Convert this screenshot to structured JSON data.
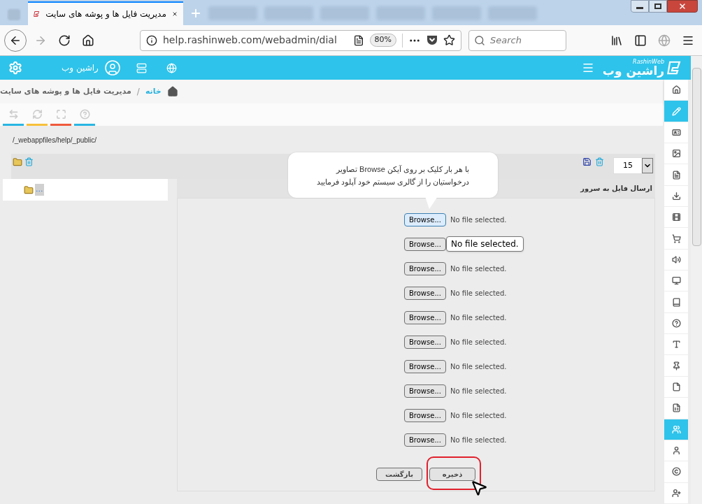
{
  "browser": {
    "tabs": [
      {
        "title": "مدیریت فایل ها و پوشه های سایت",
        "selected": true
      }
    ],
    "address": "help.rashinweb.com/webadmin/dial",
    "zoom": "80%",
    "search_placeholder": "Search"
  },
  "header": {
    "user_name": "راشین وب",
    "logo_text": "راشین وب",
    "logo_subtext": "RashinWeb"
  },
  "breadcrumb": {
    "separator": "/",
    "items": [
      {
        "label": "خانه",
        "link": true
      },
      {
        "label": "مدیریت فایل ها و پوشه های سایت",
        "link": false
      }
    ]
  },
  "toolbar": [
    {
      "kind": "resize",
      "color": "#29b6e3"
    },
    {
      "kind": "refresh",
      "color": "#f8c13a"
    },
    {
      "kind": "expand",
      "color": "#f05a3c"
    },
    {
      "kind": "help",
      "color": "#29b6e3"
    }
  ],
  "path": "/_webappfiles/help/_public/",
  "page_size": "15",
  "tree": [
    {
      "label": "..."
    }
  ],
  "callout": "با هر بار کلیک بر روی آیکن   Browse تصاویر\nدرخواستیان را از گالری سیستم خود آپلود فرمایید",
  "upload": {
    "title": "ارسال فایل به سرور",
    "rows": [
      {
        "button": "Browse...",
        "status": "No file selected.",
        "focused": true
      },
      {
        "button": "Browse...",
        "tooltip": "No file selected.",
        "focused": false
      },
      {
        "button": "Browse...",
        "status": "No file selected.",
        "focused": false
      },
      {
        "button": "Browse...",
        "status": "No file selected.",
        "focused": false
      },
      {
        "button": "Browse...",
        "status": "No file selected.",
        "focused": false
      },
      {
        "button": "Browse...",
        "status": "No file selected.",
        "focused": false
      },
      {
        "button": "Browse...",
        "status": "No file selected.",
        "focused": false
      },
      {
        "button": "Browse...",
        "status": "No file selected.",
        "focused": false
      },
      {
        "button": "Browse...",
        "status": "No file selected.",
        "focused": false
      },
      {
        "button": "Browse...",
        "status": "No file selected.",
        "focused": false
      }
    ],
    "buttons": [
      {
        "label": "ذخیره",
        "highlighted": true
      },
      {
        "label": "بازگشت",
        "highlighted": false
      }
    ]
  },
  "sidebar": [
    {
      "kind": "home",
      "selected": false
    },
    {
      "kind": "pencil",
      "selected": true
    },
    {
      "kind": "card",
      "selected": false
    },
    {
      "kind": "image",
      "selected": false
    },
    {
      "kind": "file-text",
      "selected": false
    },
    {
      "kind": "download",
      "selected": false
    },
    {
      "kind": "film",
      "selected": false
    },
    {
      "kind": "cart",
      "selected": false
    },
    {
      "kind": "volume",
      "selected": false
    },
    {
      "kind": "monitor",
      "selected": false
    },
    {
      "kind": "book",
      "selected": false
    },
    {
      "kind": "question",
      "selected": false
    },
    {
      "kind": "text-height",
      "selected": false
    },
    {
      "kind": "pin",
      "selected": false
    },
    {
      "kind": "file",
      "selected": false
    },
    {
      "kind": "spreadsheet",
      "selected": false
    },
    {
      "kind": "users",
      "selected": true
    },
    {
      "kind": "user",
      "selected": false
    },
    {
      "kind": "copyright",
      "selected": false
    },
    {
      "kind": "user-plus",
      "selected": false
    }
  ]
}
